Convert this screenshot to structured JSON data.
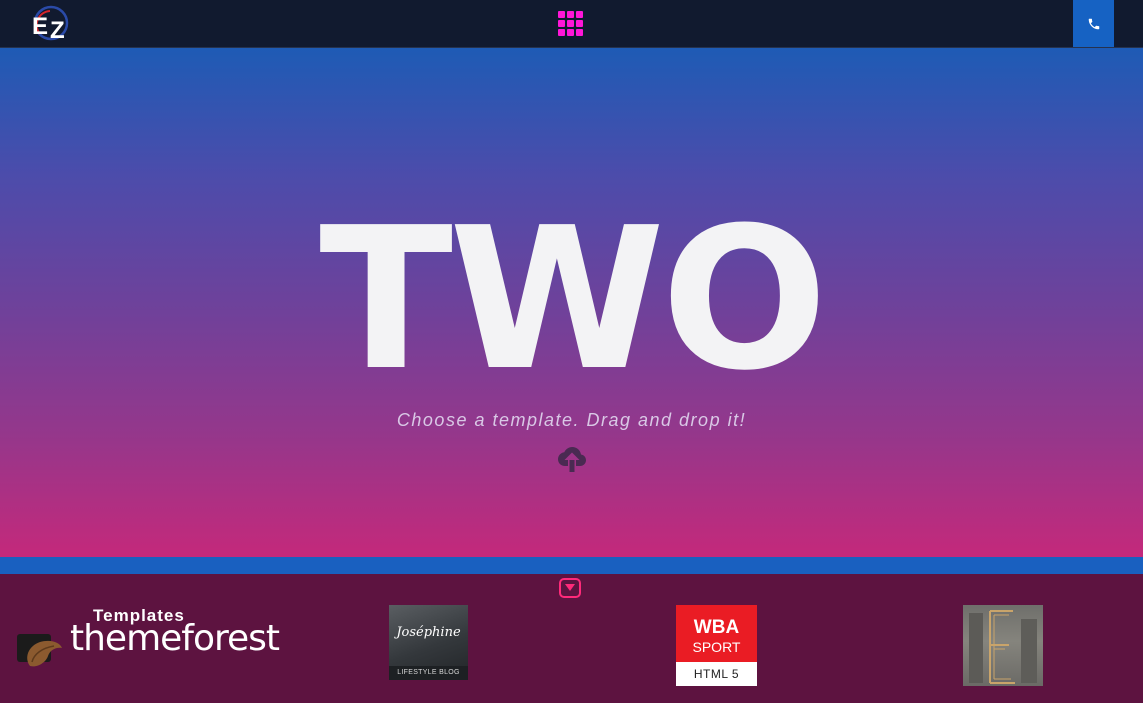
{
  "header": {
    "logo_text": "EZ",
    "grid_menu_icon": "grid-menu-icon",
    "phone_icon": "phone-icon"
  },
  "hero": {
    "title": "TWO",
    "subtitle": "Choose a template. Drag and drop it!",
    "upload_icon": "cloud-upload-icon"
  },
  "footer": {
    "toggle_icon": "chevron-down-icon",
    "themeforest": {
      "templates_label": "Templates",
      "brand": "themeforest"
    },
    "thumbnails": [
      {
        "title": "Joséphine",
        "subtitle": "LIFESTYLE BLOG"
      },
      {
        "line1": "WBA",
        "line2": "SPORT",
        "line3": "HTML 5"
      },
      {
        "title": "E"
      }
    ]
  },
  "colors": {
    "topbar": "#111a2f",
    "accent_magenta": "#ff16d8",
    "phone_button": "#1662c3",
    "gradient_top": "#1e5bb5",
    "gradient_bottom": "#c4297b",
    "footer_bg": "#5d1340"
  }
}
